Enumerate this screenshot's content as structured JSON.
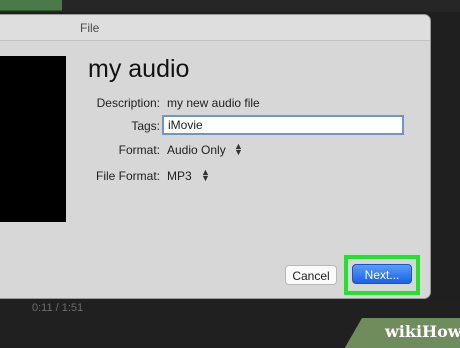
{
  "window": {
    "title": "File"
  },
  "media": {
    "name": "my audio"
  },
  "form": {
    "description_label": "Description:",
    "description_value": "my new audio file",
    "tags_label": "Tags:",
    "tags_value": "iMovie",
    "format_label": "Format:",
    "format_value": "Audio Only",
    "file_format_label": "File Format:",
    "file_format_value": "MP3"
  },
  "buttons": {
    "cancel": "Cancel",
    "next": "Next..."
  },
  "background": {
    "timecode": "0:11 / 1:51"
  },
  "watermark": {
    "text": "wikiHow"
  },
  "colors": {
    "highlight": "#22e22a",
    "primary_button": "#2f78f0",
    "dialog_bg": "#d7d7d7"
  },
  "icons": {
    "stepper": "up-down-chevron-icon"
  }
}
